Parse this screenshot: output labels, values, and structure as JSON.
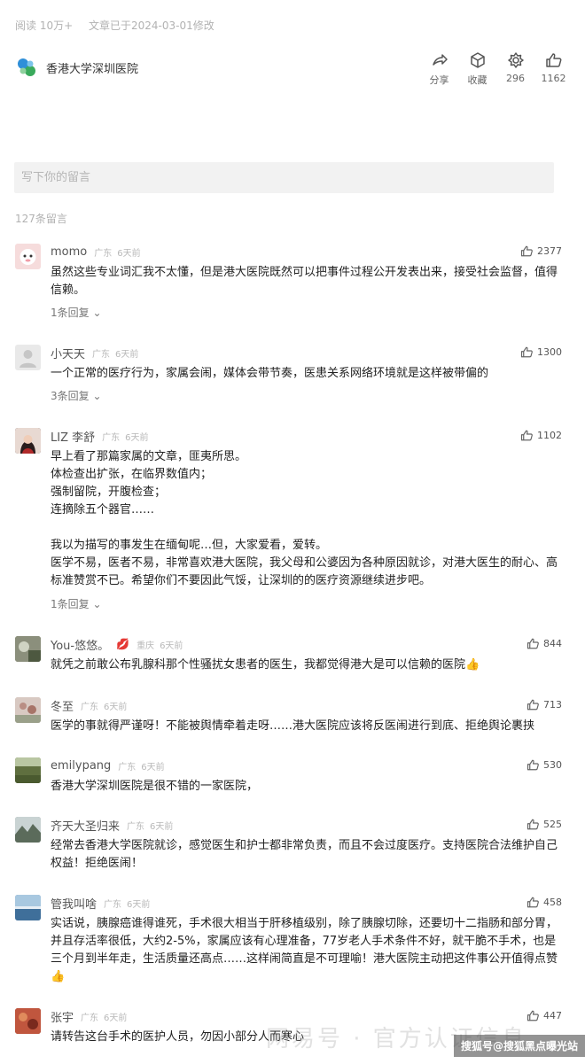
{
  "article": {
    "reads": "阅读 10万+",
    "modified": "文章已于2024-03-01修改"
  },
  "account": {
    "name": "香港大学深圳医院"
  },
  "actions": [
    {
      "icon": "share-icon",
      "label": "分享"
    },
    {
      "icon": "collect-icon",
      "label": "收藏"
    },
    {
      "icon": "gear-like-icon",
      "label": "296"
    },
    {
      "icon": "thumbs-up-icon",
      "label": "1162"
    }
  ],
  "comment_box": {
    "placeholder": "写下你的留言"
  },
  "comment_count": "127条留言",
  "comments": [
    {
      "name": "momo",
      "location": "广东",
      "time": "6天前",
      "likes": "2377",
      "text": "虽然这些专业词汇我不太懂，但是港大医院既然可以把事件过程公开发表出来，接受社会监督，值得信赖。",
      "reply": "1条回复 ⌄"
    },
    {
      "name": "小天天",
      "location": "广东",
      "time": "6天前",
      "likes": "1300",
      "text": "一个正常的医疗行为，家属会闹，媒体会带节奏，医患关系网络环境就是这样被带偏的",
      "reply": "3条回复 ⌄"
    },
    {
      "name": "LIZ 李舒",
      "location": "广东",
      "time": "6天前",
      "likes": "1102",
      "text": "早上看了那篇家属的文章，匪夷所思。\n体检查出扩张，在临界数值内；\n强制留院，开腹检查；\n连摘除五个器官……\n\n我以为描写的事发生在缅甸呢…但，大家爱看，爱转。\n医学不易，医者不易，非常喜欢港大医院，我父母和公婆因为各种原因就诊，对港大医生的耐心、高标准赞赏不已。希望你们不要因此气馁，让深圳的的医疗资源继续进步吧。",
      "reply": "1条回复 ⌄"
    },
    {
      "name": "You-悠悠。",
      "location": "重庆",
      "time": "6天前",
      "likes": "844",
      "emoji": "💋",
      "text": "就凭之前敢公布乳腺科那个性骚扰女患者的医生，我都觉得港大是可以信赖的医院👍"
    },
    {
      "name": "冬至",
      "location": "广东",
      "time": "6天前",
      "likes": "713",
      "text": "医学的事就得严谨呀！不能被舆情牵着走呀……港大医院应该将反医闹进行到底、拒绝舆论裹挟"
    },
    {
      "name": "emilypang",
      "location": "广东",
      "time": "6天前",
      "likes": "530",
      "text": "香港大学深圳医院是很不错的一家医院，"
    },
    {
      "name": "齐天大圣归来",
      "location": "广东",
      "time": "6天前",
      "likes": "525",
      "text": "经常去香港大学医院就诊，感觉医生和护士都非常负责，而且不会过度医疗。支持医院合法维护自己权益！拒绝医闹！"
    },
    {
      "name": "管我叫啥",
      "location": "广东",
      "time": "6天前",
      "likes": "458",
      "text": "实话说，胰腺癌谁得谁死，手术很大相当于肝移植级别，除了胰腺切除，还要切十二指肠和部分胃，并且存活率很低，大约2-5%，家属应该有心理准备，77岁老人手术条件不好，就干脆不手术，也是三个月到半年走，生活质量还高点……这样闹简直是不可理喻！港大医院主动把这件事公开值得点赞👍"
    },
    {
      "name": "张宇",
      "location": "广东",
      "time": "6天前",
      "likes": "447",
      "text": "请转告这台手术的医护人员，勿因小部分人而寒心"
    }
  ],
  "watermark": {
    "faint": "网易号 · 官方认证信息",
    "label": "搜狐号@搜狐黑点曝光站"
  },
  "colors": {
    "accent_blue": "#2f8fd8",
    "accent_green": "#3aaa5c",
    "placeholder": "#b5b5b5"
  }
}
